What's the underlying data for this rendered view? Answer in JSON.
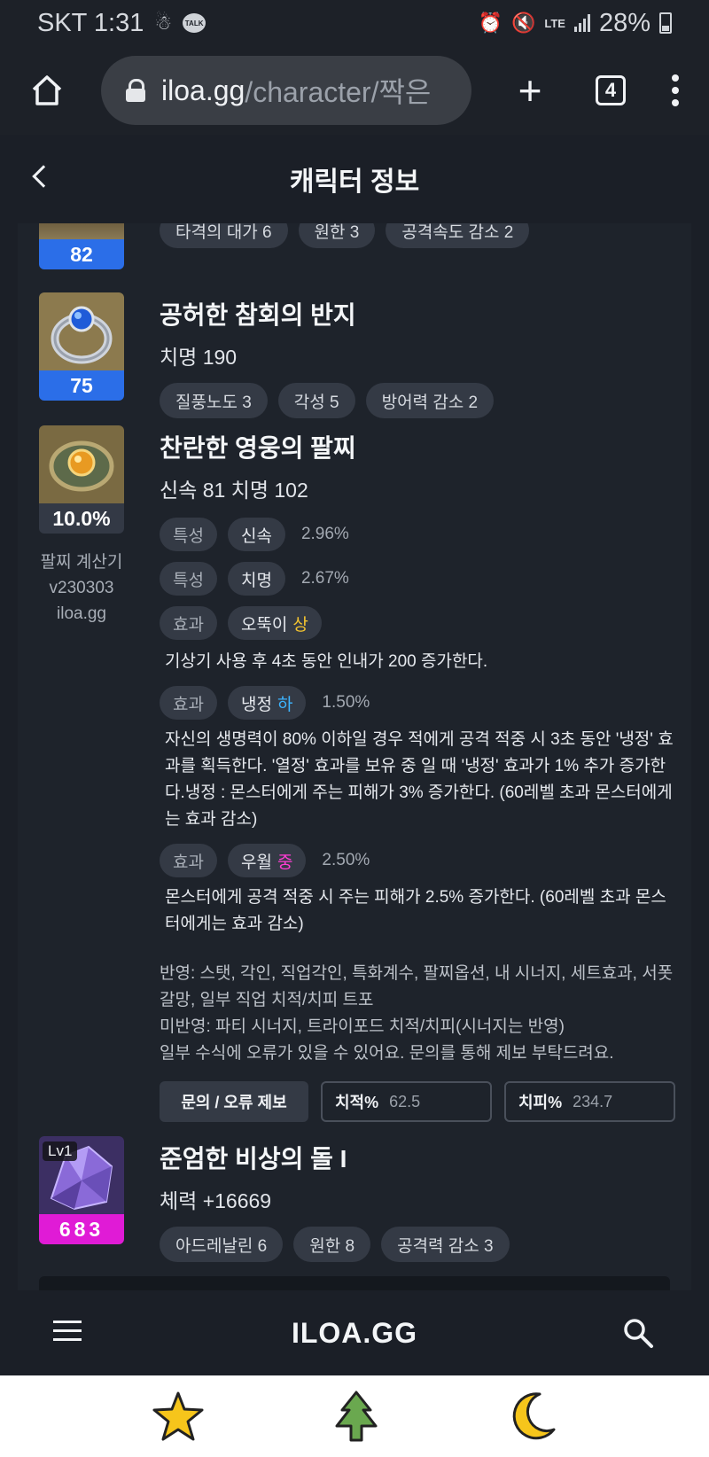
{
  "status_bar": {
    "carrier_time": "SKT 1:31",
    "talk_badge": "TALK",
    "network": "LTE",
    "battery": "28%"
  },
  "browser": {
    "url_host": "iloa.gg",
    "url_path": "/character/짝은",
    "tab_count": "4"
  },
  "header": {
    "title": "캐릭터 정보"
  },
  "items": [
    {
      "level": "82",
      "chips": [
        "타격의 대가 6",
        "원한 3",
        "공격속도 감소 2"
      ]
    },
    {
      "name": "공허한 참회의 반지",
      "stat": "치명 190",
      "level": "75",
      "chips": [
        "질풍노도 3",
        "각성 5",
        "방어력 감소 2"
      ]
    }
  ],
  "bracelet": {
    "name": "찬란한 영웅의 팔찌",
    "stat": "신속 81  치명 102",
    "percent": "10.0%",
    "calc_label_1": "팔찌 계산기",
    "calc_label_2": "v230303",
    "calc_label_3": "iloa.gg",
    "options": [
      {
        "type": "특성",
        "value": "신속",
        "grade": "",
        "pct": "2.96%"
      },
      {
        "type": "특성",
        "value": "치명",
        "grade": "",
        "pct": "2.67%"
      },
      {
        "type": "효과",
        "value": "오뚝이",
        "grade": "상",
        "pct": "",
        "desc": "기상기 사용 후 4초 동안 인내가 200 증가한다."
      },
      {
        "type": "효과",
        "value": "냉정",
        "grade": "하",
        "pct": "1.50%",
        "desc": "자신의 생명력이 80% 이하일 경우 적에게 공격 적중 시 3초 동안 '냉정' 효과를 획득한다. '열정' 효과를 보유 중 일 때 '냉정' 효과가 1% 추가 증가한다.냉정 : 몬스터에게 주는 피해가 3% 증가한다. (60레벨 초과 몬스터에게는 효과 감소)"
      },
      {
        "type": "효과",
        "value": "우월",
        "grade": "중",
        "pct": "2.50%",
        "desc": "몬스터에게 공격 적중 시 주는 피해가 2.5% 증가한다. (60레벨 초과 몬스터에게는 효과 감소)"
      }
    ],
    "note_1": "반영: 스탯, 각인, 직업각인, 특화계수, 팔찌옵션, 내 시너지, 세트효과, 서폿 갈망, 일부 직업 치적/치피 트포",
    "note_2": "미반영: 파티 시너지, 트라이포드 치적/치피(시너지는 반영)",
    "note_3": "일부 수식에 오류가 있을 수 있어요. 문의를 통해 제보 부탁드려요.",
    "report_button": "문의 / 오류 제보",
    "crit_rate_label": "치적%",
    "crit_rate_value": "62.5",
    "crit_dmg_label": "치피%",
    "crit_dmg_value": "234.7"
  },
  "stone": {
    "name": "준엄한 비상의 돌 I",
    "stat": "체력 +16669",
    "lv_badge": "Lv1",
    "level": "683",
    "chips": [
      "아드레날린 6",
      "원한 8",
      "공격력 감소 3"
    ]
  },
  "site_nav": {
    "logo": "ILOA.GG"
  },
  "colors": {
    "blue_bar": "#2b6ee8",
    "magenta_bar": "#e01bd6",
    "grade_high": "#f4c430",
    "grade_low": "#3db4ff",
    "grade_mid": "#ff3ed5"
  }
}
